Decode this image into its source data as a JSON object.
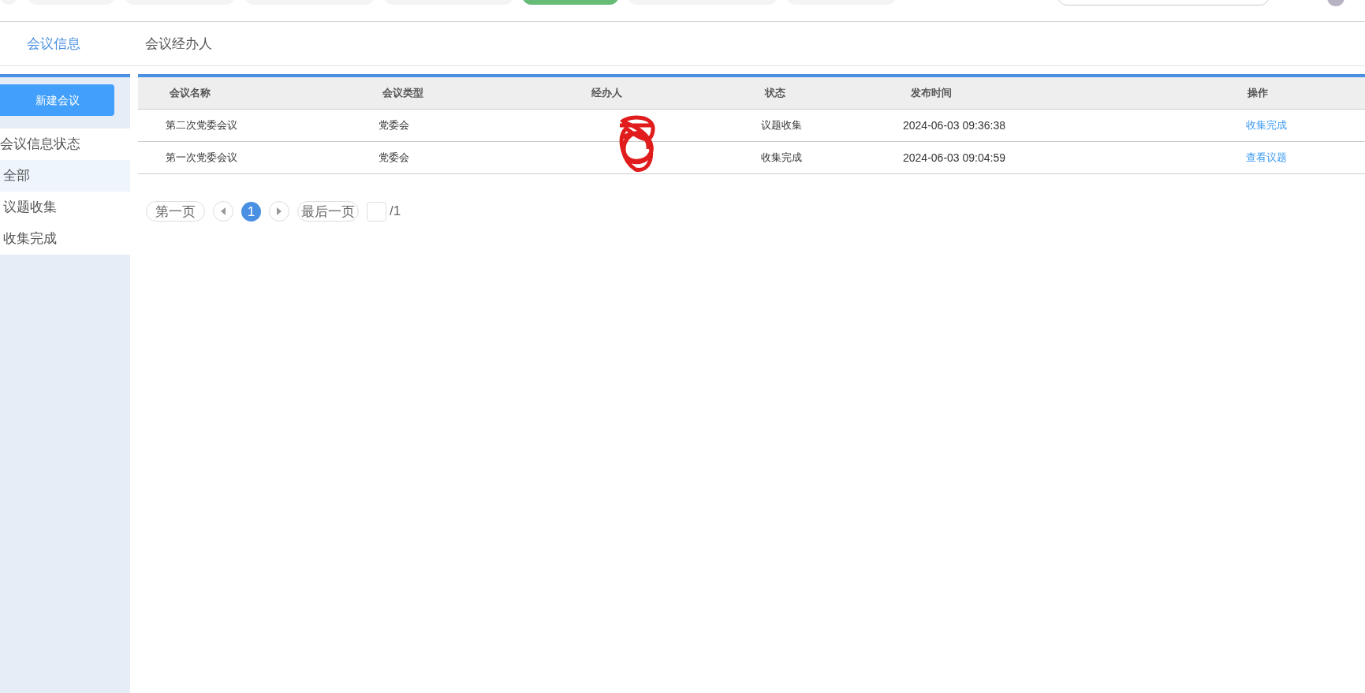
{
  "top_nav": {
    "pills": [
      {
        "selected": false
      },
      {
        "selected": false
      },
      {
        "selected": false
      },
      {
        "selected": false
      },
      {
        "selected": false
      },
      {
        "selected": true
      },
      {
        "selected": false
      },
      {
        "selected": false
      }
    ]
  },
  "tabs": [
    {
      "label": "会议信息",
      "selected": true
    },
    {
      "label": "会议经办人",
      "selected": false
    }
  ],
  "sidebar": {
    "new_button": "新建会议",
    "heading": "会议信息状态",
    "items": [
      {
        "label": "全部",
        "selected": true
      },
      {
        "label": "议题收集",
        "selected": false
      },
      {
        "label": "收集完成",
        "selected": false
      }
    ]
  },
  "table": {
    "columns": [
      "会议名称",
      "会议类型",
      "经办人",
      "状态",
      "发布时间",
      "操作"
    ],
    "rows": [
      {
        "name": "第二次党委会议",
        "type": "党委会",
        "status": "议题收集",
        "time": "2024-06-03 09:36:38",
        "action": "收集完成"
      },
      {
        "name": "第一次党委会议",
        "type": "党委会",
        "status": "收集完成",
        "time": "2024-06-03 09:04:59",
        "action": "查看议题"
      }
    ]
  },
  "pagination": {
    "first": "第一页",
    "pages": [
      {
        "label": "1",
        "selected": true
      }
    ],
    "last": "最后一页",
    "total": "/1"
  }
}
